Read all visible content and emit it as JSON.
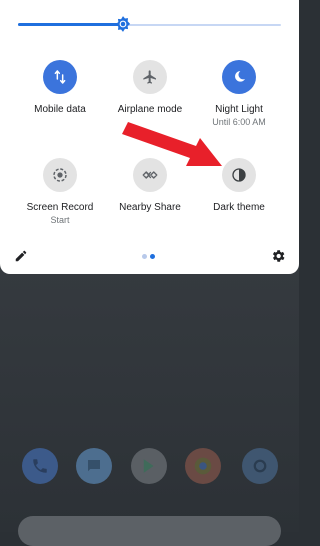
{
  "brightness": {
    "level_percent": 40
  },
  "tiles": [
    {
      "label": "Mobile data",
      "sub": "",
      "icon": "mobile-data-icon",
      "state": "on"
    },
    {
      "label": "Airplane mode",
      "sub": "",
      "icon": "airplane-icon",
      "state": "off"
    },
    {
      "label": "Night Light",
      "sub": "Until 6:00 AM",
      "icon": "moon-icon",
      "state": "on"
    },
    {
      "label": "Screen Record",
      "sub": "Start",
      "icon": "screen-record-icon",
      "state": "off"
    },
    {
      "label": "Nearby Share",
      "sub": "",
      "icon": "nearby-share-icon",
      "state": "off"
    },
    {
      "label": "Dark theme",
      "sub": "",
      "icon": "dark-theme-icon",
      "state": "off"
    }
  ],
  "pager": {
    "current_page": 2,
    "total_pages": 2
  },
  "dock_apps": [
    "phone-icon",
    "messages-icon",
    "play-store-icon",
    "chrome-icon",
    "settings-app-icon"
  ],
  "colors": {
    "accent": "#1f6fde",
    "tile_on": "#3b74dc",
    "tile_off": "#e3e3e3",
    "annotation_arrow": "#e8202a"
  }
}
